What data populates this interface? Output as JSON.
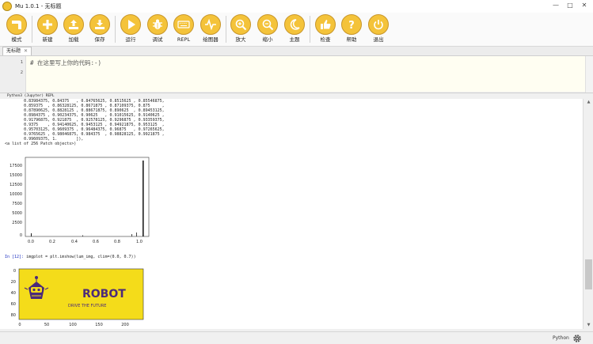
{
  "window": {
    "title": "Mu 1.0.1 - 无标题"
  },
  "toolbar": {
    "buttons": [
      {
        "label": "模式",
        "icon": "mode-icon"
      },
      {
        "label": "新建",
        "icon": "plus-icon"
      },
      {
        "label": "加载",
        "icon": "upload-icon"
      },
      {
        "label": "保存",
        "icon": "download-icon"
      },
      {
        "label": "运行",
        "icon": "play-icon"
      },
      {
        "label": "调试",
        "icon": "bug-icon"
      },
      {
        "label": "REPL",
        "icon": "keyboard-icon"
      },
      {
        "label": "绘图器",
        "icon": "waveform-icon"
      },
      {
        "label": "放大",
        "icon": "zoom-in-icon"
      },
      {
        "label": "缩小",
        "icon": "zoom-out-icon"
      },
      {
        "label": "主题",
        "icon": "moon-icon"
      },
      {
        "label": "检查",
        "icon": "thumbs-up-icon"
      },
      {
        "label": "帮助",
        "icon": "question-icon"
      },
      {
        "label": "退出",
        "icon": "power-icon"
      }
    ],
    "accent": "#f4c33a"
  },
  "editor": {
    "tab_label": "无标题",
    "lines": [
      {
        "no": "1",
        "text": "# 在这里写上你的代码:-)"
      },
      {
        "no": "2",
        "text": ""
      }
    ]
  },
  "repl": {
    "title": "Python3 (Jupyter) REPL",
    "output_lines": [
      "        0.83984375, 0.84375   , 0.84765625, 0.8515625 , 0.85546875,",
      "        0.859375  , 0.86328125, 0.8671875 , 0.87109375, 0.875     ,",
      "        0.87890625, 0.8828125 , 0.88671875, 0.890625  , 0.89453125,",
      "        0.8984375 , 0.90234375, 0.90625   , 0.91015625, 0.9140625 ,",
      "        0.91796875, 0.921875  , 0.92578125, 0.9296875 , 0.93359375,",
      "        0.9375    , 0.94140625, 0.9453125 , 0.94921875, 0.953125  ,",
      "        0.95703125, 0.9609375 , 0.96484375, 0.96875   , 0.97265625,",
      "        0.9765625 , 0.98046875, 0.984375  , 0.98828125, 0.9921875 ,",
      "        0.99609375, 1.        ]),",
      " <a list of 256 Patch objects>)"
    ],
    "input_prompt": "In [12]:",
    "input_code": " imgplot = plt.imshow(lum_img, clim=(0.0, 0.7))"
  },
  "histogram": {
    "y_ticks": [
      "17500",
      "15000",
      "12500",
      "10000",
      "7500",
      "5000",
      "2500",
      "0"
    ],
    "x_ticks": [
      "0.0",
      "0.2",
      "0.4",
      "0.6",
      "0.8",
      "1.0"
    ]
  },
  "image_plot": {
    "y_ticks": [
      "0",
      "20",
      "40",
      "60",
      "80"
    ],
    "x_ticks": [
      "0",
      "50",
      "100",
      "150",
      "200"
    ],
    "logo_text": "ROBOT",
    "logo_tagline": "DRIVE THE FUTURE",
    "bg_color": "#f4dc1a",
    "logo_color": "#4b2a7a"
  },
  "statusbar": {
    "mode": "Python"
  }
}
